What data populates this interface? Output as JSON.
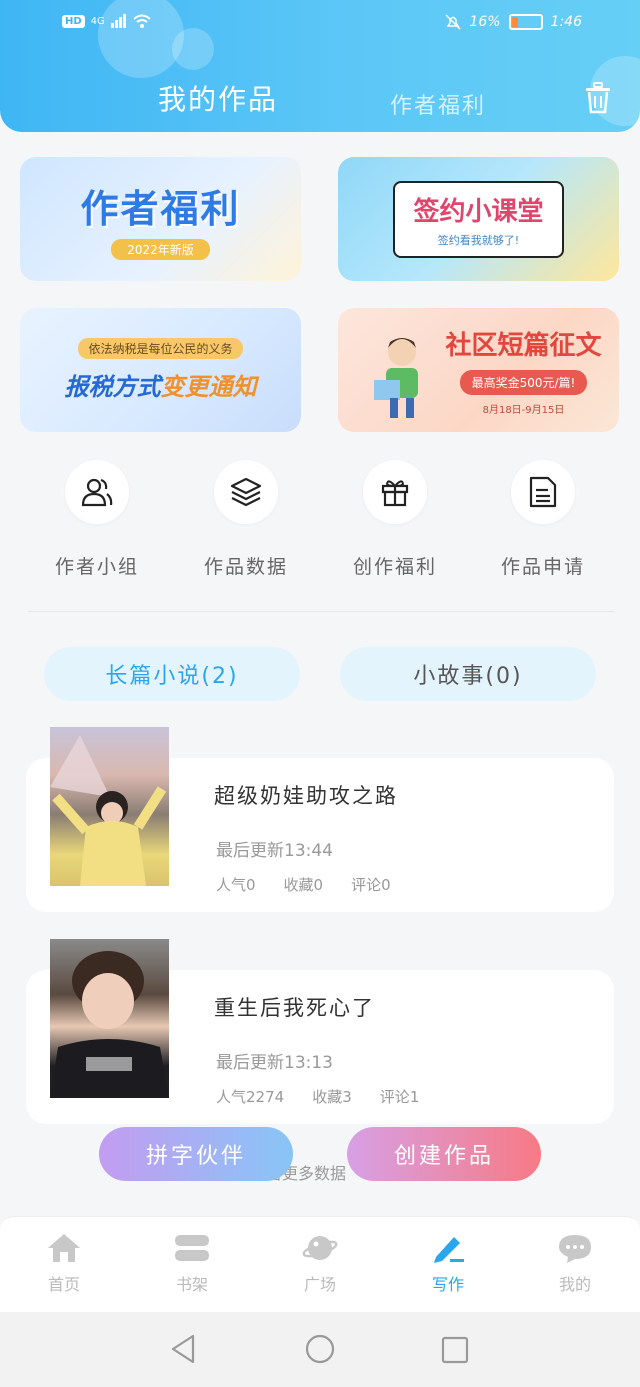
{
  "status": {
    "hd": "HD",
    "signal": "4G",
    "battery": "16%",
    "time": "1:46"
  },
  "header": {
    "tab_active": "我的作品",
    "tab_inactive": "作者福利"
  },
  "banners": [
    {
      "title": "作者福利",
      "subtitle": "2022年新版"
    },
    {
      "title": "签约小课堂",
      "subtitle": "签约看我就够了!"
    },
    {
      "subtitle": "依法纳税是每位公民的义务",
      "title_a": "报税方式",
      "title_b": "变更通知"
    },
    {
      "title": "社区短篇征文",
      "subtitle": "最高奖金500元/篇!",
      "date": "8月18日-9月15日"
    }
  ],
  "features": [
    {
      "label": "作者小组",
      "icon": "group-icon"
    },
    {
      "label": "作品数据",
      "icon": "layers-icon"
    },
    {
      "label": "创作福利",
      "icon": "gift-icon"
    },
    {
      "label": "作品申请",
      "icon": "document-icon"
    }
  ],
  "categories": [
    {
      "label": "长篇小说(2)",
      "active": true
    },
    {
      "label": "小故事(0)",
      "active": false
    }
  ],
  "works": [
    {
      "title": "超级奶娃助攻之路",
      "update": "最后更新13:44",
      "popularity": "人气0",
      "favorites": "收藏0",
      "comments": "评论0"
    },
    {
      "title": "重生后我死心了",
      "update": "最后更新13:13",
      "popularity": "人气2274",
      "favorites": "收藏3",
      "comments": "评论1"
    }
  ],
  "more_text": "查看更多数据",
  "actions": {
    "partner": "拼字伙伴",
    "create": "创建作品"
  },
  "nav": [
    {
      "label": "首页",
      "icon": "home-icon"
    },
    {
      "label": "书架",
      "icon": "bookshelf-icon"
    },
    {
      "label": "广场",
      "icon": "planet-icon"
    },
    {
      "label": "写作",
      "icon": "pen-icon",
      "active": true
    },
    {
      "label": "我的",
      "icon": "chat-icon"
    }
  ],
  "colors": {
    "accent": "#2aa6ee",
    "header": "#4dbdf5"
  }
}
